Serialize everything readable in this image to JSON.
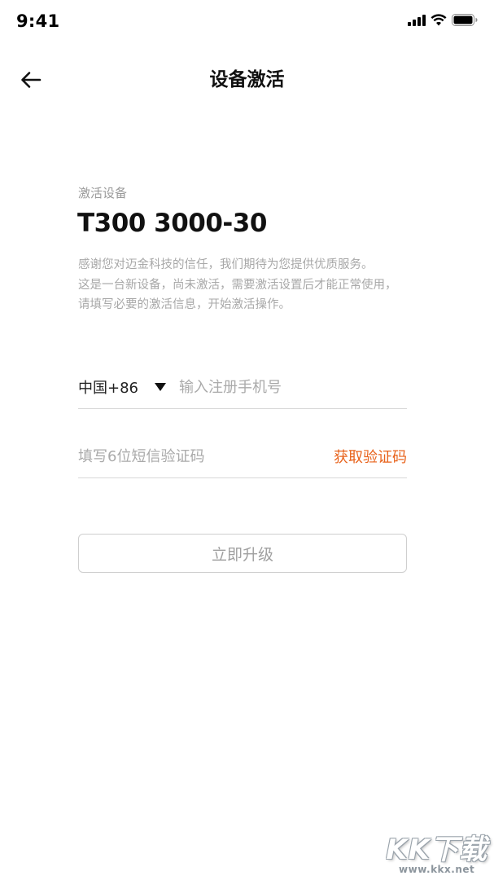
{
  "status_bar": {
    "time": "9:41"
  },
  "nav": {
    "title": "设备激活"
  },
  "device": {
    "section_label": "激活设备",
    "name": "T300 3000-30",
    "description_lines": [
      "感谢您对迈金科技的信任，我们期待为您提供优质服务。",
      "这是一台新设备，尚未激活，需要激活设置后才能正常使用，",
      "请填写必要的激活信息，开始激活操作。"
    ]
  },
  "form": {
    "country_code": "中国+86",
    "phone_placeholder": "输入注册手机号",
    "code_placeholder": "填写6位短信验证码",
    "get_code_label": "获取验证码",
    "submit_label": "立即升级"
  },
  "watermark": {
    "logo": "KK下载",
    "url": "www.kkx.net"
  },
  "colors": {
    "accent": "#e8631c",
    "muted_text": "#a8a8a8",
    "divider": "#d8d8d8"
  }
}
